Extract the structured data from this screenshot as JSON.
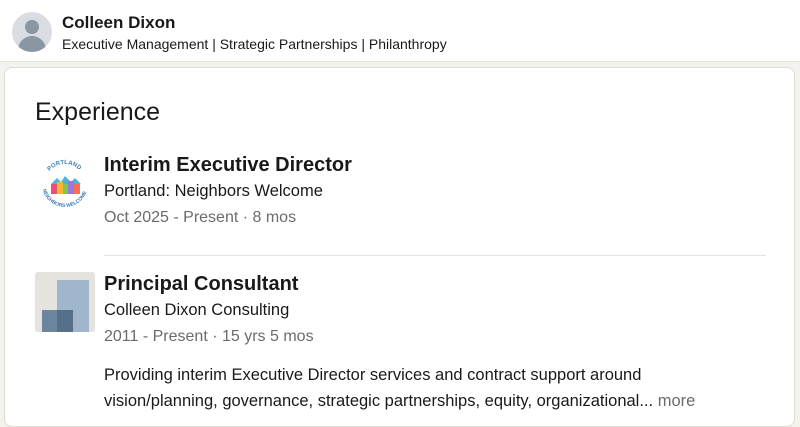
{
  "profile": {
    "name": "Colleen Dixon",
    "headline": "Executive Management | Strategic Partnerships | Philanthropy"
  },
  "experience": {
    "title": "Experience",
    "items": [
      {
        "role": "Interim Executive Director",
        "company": "Portland: Neighbors Welcome",
        "dates": "Oct 2025 - Present · 8 mos",
        "logo_text_top": "PORTLAND",
        "logo_text_bottom": "NEIGHBORS WELCOME"
      },
      {
        "role": "Principal Consultant",
        "company": "Colleen Dixon Consulting",
        "dates": "2011 - Present · 15 yrs 5 mos",
        "description_line1": "Providing interim Executive Director services and contract support around",
        "description_line2": "vision/planning, governance, strategic partnerships, equity, organizational...",
        "more_label": "more"
      }
    ]
  }
}
